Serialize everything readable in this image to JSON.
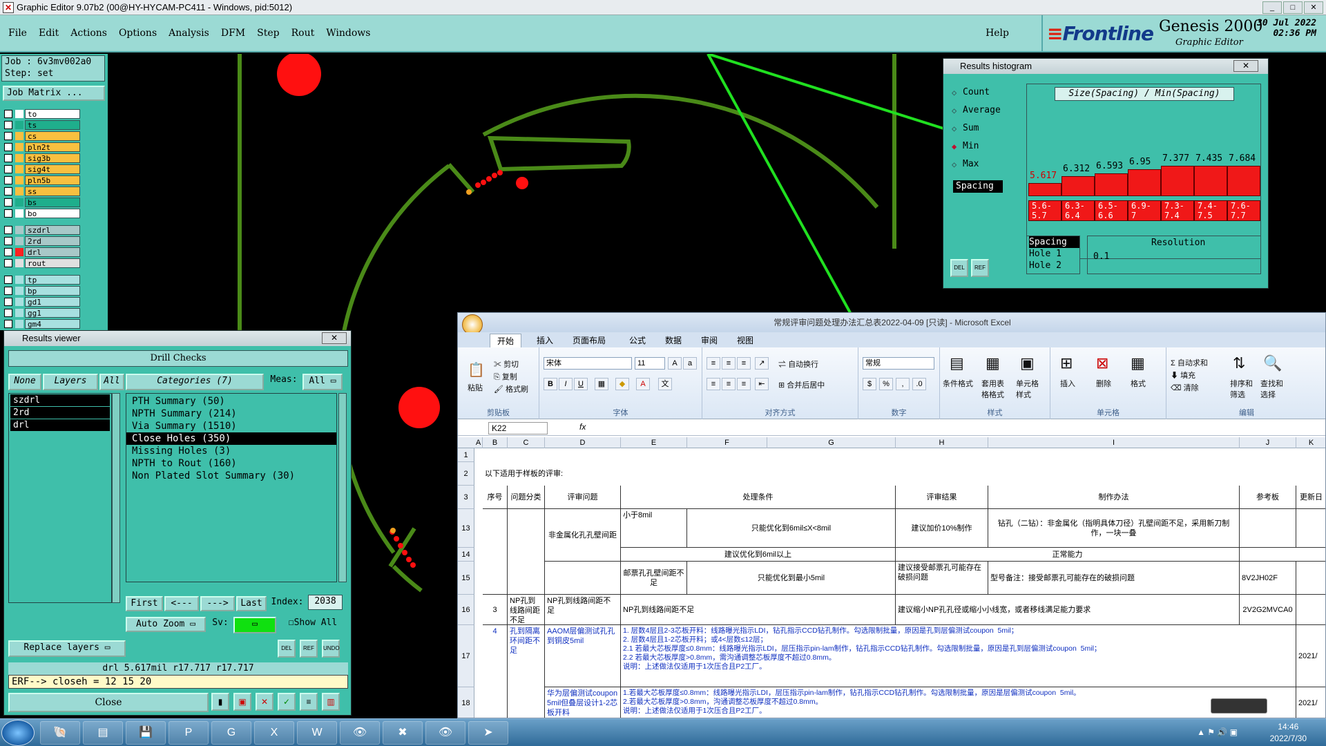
{
  "window": {
    "title": "Graphic Editor 9.07b2 (00@HY-HYCAM-PC411 - Windows, pid:5012)",
    "min": "_",
    "max": "□",
    "close": "✕"
  },
  "menu": {
    "items": [
      "File",
      "Edit",
      "Actions",
      "Options",
      "Analysis",
      "DFM",
      "Step",
      "Rout",
      "Windows"
    ],
    "help": "Help"
  },
  "brand": {
    "logo": "Frontline",
    "product": "Genesis 2000",
    "subtitle": "Graphic Editor",
    "date": "30 Jul  2022",
    "time": "02:36 PM"
  },
  "job": {
    "job_line": "Job : 6v3mv002a0",
    "step_line": "Step: set",
    "job_matrix_label": "Job Matrix ..."
  },
  "layers": [
    {
      "name": "to",
      "bg": "#ffffff",
      "swatch": "#ffffff"
    },
    {
      "name": "ts",
      "bg": "#1fae8c",
      "swatch": "#1fae8c"
    },
    {
      "name": "cs",
      "bg": "#f8c040",
      "swatch": "#f8c040"
    },
    {
      "name": "pln2t",
      "bg": "#f8c040",
      "swatch": "#f8c040"
    },
    {
      "name": "sig3b",
      "bg": "#f8c040",
      "swatch": "#f8c040"
    },
    {
      "name": "sig4t",
      "bg": "#f8c040",
      "swatch": "#f8c040"
    },
    {
      "name": "pln5b",
      "bg": "#f8c040",
      "swatch": "#f8c040"
    },
    {
      "name": "ss",
      "bg": "#f8c040",
      "swatch": "#f8c040"
    },
    {
      "name": "bs",
      "bg": "#1fae8c",
      "swatch": "#1fae8c"
    },
    {
      "name": "bo",
      "bg": "#ffffff",
      "swatch": "#ffffff"
    },
    {
      "name": "szdrl",
      "bg": "#a8c8c8",
      "swatch": "#a8c8c8"
    },
    {
      "name": "2rd",
      "bg": "#a8c8c8",
      "swatch": "#a8c8c8"
    },
    {
      "name": "drl",
      "bg": "#a8c8c8",
      "swatch": "#ff2020"
    },
    {
      "name": "rout",
      "bg": "#e0e0e0",
      "swatch": "#e0e0e0"
    },
    {
      "name": "tp",
      "bg": "#a8e0e0",
      "swatch": "#a8e0e0"
    },
    {
      "name": "bp",
      "bg": "#a8e0e0",
      "swatch": "#a8e0e0"
    },
    {
      "name": "gd1",
      "bg": "#a8e0e0",
      "swatch": "#a8e0e0"
    },
    {
      "name": "gg1",
      "bg": "#a8e0e0",
      "swatch": "#a8e0e0"
    },
    {
      "name": "gm4",
      "bg": "#a8e0e0",
      "swatch": "#a8e0e0"
    }
  ],
  "results_viewer": {
    "title": "Results viewer",
    "close_x": "✕",
    "header": "Drill Checks",
    "none_btn": "None",
    "layers_btn": "Layers",
    "all_btn": "All",
    "categories_label": "Categories (7)",
    "meas_label": "Meas:",
    "meas_value": "All",
    "layer_items": [
      "szdrl",
      "2rd",
      "drl"
    ],
    "categories": [
      "PTH Summary (50)",
      "NPTH Summary (214)",
      "Via Summary (1510)",
      "Close Holes (350)",
      "Missing Holes (3)",
      "NPTH to Rout (160)",
      "Non Plated Slot Summary (30)"
    ],
    "selected_category": "Close Holes (350)",
    "first": "First",
    "prev": "<---",
    "next": "--->",
    "last": "Last",
    "index_label": "Index:",
    "index_value": "2038",
    "auto_zoom": "Auto Zoom",
    "sv_label": "Sv:",
    "show_all": "Show All",
    "replace_layers": "Replace layers",
    "del": "DEL",
    "ref": "REF",
    "undo": "UNDO",
    "readout": "drl  5.617mil   r17.717   r17.717",
    "erf": "ERF--> closeh = 12 15 20",
    "close": "Close"
  },
  "histogram": {
    "title": "Results histogram",
    "close_x": "✕",
    "options": [
      "Count",
      "Average",
      "Sum",
      "Min",
      "Max"
    ],
    "selected_option": "Min",
    "selected_measure": "Spacing",
    "plot_title": "Size(Spacing) / Min(Spacing)",
    "min_values": [
      5.617,
      6.312,
      6.593,
      6.95,
      7.377,
      7.435,
      7.684
    ],
    "min_value_labels": [
      "5.617",
      "6.312",
      "6.593",
      "6.95",
      "7.377",
      "7.435",
      "7.684"
    ],
    "bins": [
      {
        "from": "5.6-",
        "to": "5.7"
      },
      {
        "from": "6.3-",
        "to": "6.4"
      },
      {
        "from": "6.5-",
        "to": "6.6"
      },
      {
        "from": "6.9-",
        "to": "7"
      },
      {
        "from": "7.3-",
        "to": "7.4"
      },
      {
        "from": "7.4-",
        "to": "7.5"
      },
      {
        "from": "7.6-",
        "to": "7.7"
      }
    ],
    "measures": [
      "Spacing",
      "Hole 1",
      "Hole 2"
    ],
    "resolution_label": "Resolution",
    "resolution_value": "0.1",
    "del": "DEL",
    "ref": "REF",
    "bar_color": "#f01818"
  },
  "excel": {
    "title": "常规评审问题处理办法汇总表2022-04-09 [只读] - Microsoft Excel",
    "tabs": [
      "开始",
      "插入",
      "页面布局",
      "公式",
      "数据",
      "审阅",
      "视图"
    ],
    "active_tab": "开始",
    "clipboard": {
      "cut": "剪切",
      "copy": "复制",
      "format_painter": "格式刷",
      "paste": "粘贴",
      "label": "剪贴板"
    },
    "font": {
      "name": "宋体",
      "size": "11",
      "label": "字体"
    },
    "alignment": {
      "wrap": "自动换行",
      "merge": "合并后居中",
      "label": "对齐方式"
    },
    "number": {
      "format": "常规",
      "label": "数字"
    },
    "styles": {
      "cond": "条件格式",
      "table": "套用表格格式",
      "cell": "单元格样式",
      "label": "样式"
    },
    "cells": {
      "insert": "插入",
      "delete": "删除",
      "format": "格式",
      "label": "单元格"
    },
    "editing": {
      "autosum": "自动求和",
      "fill": "填充",
      "clear": "清除",
      "sort": "排序和筛选",
      "find": "查找和选择",
      "label": "编辑"
    },
    "namebox": "K22",
    "fx": "fx",
    "columns": [
      "A",
      "B",
      "C",
      "D",
      "E",
      "F",
      "G",
      "H",
      "I",
      "J",
      "K"
    ],
    "rows": {
      "r2": "以下适用于样板的评审:",
      "headers": [
        "序号",
        "问题分类",
        "评审问题",
        "处理条件",
        "评审结果",
        "制作办法",
        "参考板",
        "更新日"
      ],
      "r13": {
        "issue": "非金属化孔孔壁间距",
        "cond1": "小于8mil",
        "cond2": "只能优化到6mil≤X<8mil",
        "result": "建议加价10%制作",
        "method": "钻孔（二钻）：非金属化（指明具体刀径）孔壁间距不足，采用新刀制作，一块一叠"
      },
      "r14": {
        "cond": "建议优化到6mil以上",
        "method": "正常能力"
      },
      "r15": {
        "cond1": "邮票孔孔壁间距不足",
        "cond2": "只能优化到最小5mil",
        "result": "建议接受邮票孔可能存在破损问题",
        "method": "型号备注：接受邮票孔可能存在的破损问题",
        "ref": "8V2JH02F"
      },
      "r16": {
        "no": "3",
        "cat": "NP孔到线路间距不足",
        "issue": "NP孔到线路间距不足",
        "cond": "NP孔到线路间距不足",
        "result": "建议缩小NP孔孔径或缩小小线宽，或者移线满足能力要求",
        "ref": "2V2G2MVCA0"
      },
      "r17": {
        "no": "4",
        "cat": "孔到隔离环间距不足",
        "issue": "AAOM层偏测试孔孔到铜皮5mil",
        "text": "1. 层数4层且2-3芯板开料：线路曝光指示LDI，钻孔指示CCD钻孔制作。勾选限制批量，原因是孔到层偏测试coupon  5mil；\n2. 层数4层且1-2芯板开料；或4<层数≤12层；\n2.1 若最大芯板厚度≤0.8mm：线路曝光指示LDI，层压指示pin-lam制作，钻孔指示CCD钻孔制作。勾选限制批量，原因是孔到层偏测试coupon  5mil；\n2.2 若最大芯板厚度>0.8mm，需沟通调整芯板厚度不超过0.8mm。\n说明：上述做法仅适用于1次压合且P2工厂。",
        "date": "2021/"
      },
      "r18": {
        "issue": "华为层偏测试coupon 5mil但叠层设计1-2芯板开料",
        "text": "1.若最大芯板厚度≤0.8mm：线路曝光指示LDI，层压指示pin-lam制作，钻孔指示CCD钻孔制作。勾选限制批量，原因是层偏测试coupon  5mil。\n2.若最大芯板厚度>0.8mm，沟通调整芯板厚度不超过0.8mm。\n说明：上述做法仅适用于1次压合且P2工厂。",
        "date": "2021/"
      }
    }
  },
  "taskbar": {
    "time": "14:46",
    "date": "2022/7/30",
    "items": [
      "🐚",
      "▤",
      "💾",
      "P",
      "G",
      "X",
      "W",
      "👁",
      "✖",
      "👁",
      "➤"
    ]
  }
}
